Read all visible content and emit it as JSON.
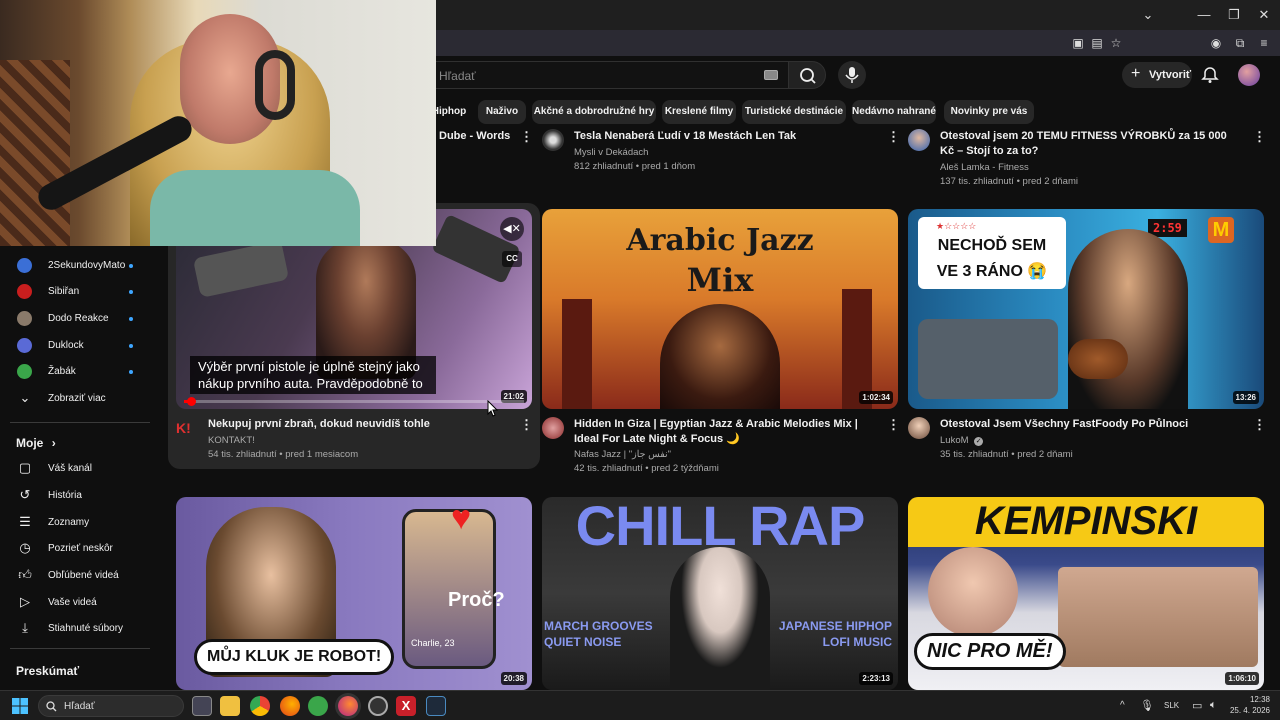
{
  "browser": {
    "controls": {
      "minimize": "—",
      "restore": "❐",
      "close": "✕"
    }
  },
  "header": {
    "search_placeholder": "Hľadať",
    "create_label": "Vytvoriť"
  },
  "chips": [
    "Hiphop",
    "Naživo",
    "Akčné a dobrodružné hry",
    "Kreslené filmy",
    "Turistické destinácie",
    "Nedávno nahrané",
    "Novinky pre vás"
  ],
  "sidebar": {
    "subscriptions": [
      {
        "name": "2SekundovyMato",
        "color": "#3b6fd6"
      },
      {
        "name": "Sibiřan",
        "color": "#c81e1e"
      },
      {
        "name": "Dodo Reakce",
        "color": "#8a7a6a"
      },
      {
        "name": "Duklock",
        "color": "#5a6ad6"
      },
      {
        "name": "Žabák",
        "color": "#3aa64a"
      }
    ],
    "show_more": "Zobraziť viac",
    "you_title": "Moje",
    "you_items": [
      {
        "label": "Váš kanál",
        "icon": "channel-icon"
      },
      {
        "label": "História",
        "icon": "history-icon"
      },
      {
        "label": "Zoznamy",
        "icon": "playlists-icon"
      },
      {
        "label": "Pozrieť neskôr",
        "icon": "watch-later-icon"
      },
      {
        "label": "Obľúbené videá",
        "icon": "liked-icon"
      },
      {
        "label": "Vaše videá",
        "icon": "your-videos-icon"
      },
      {
        "label": "Stiahnuté súbory",
        "icon": "downloads-icon"
      }
    ],
    "explore_title": "Preskúmať"
  },
  "top_row": [
    {
      "title": "Dube - Words"
    },
    {
      "title": "Tesla Nenaberá Ľudí v 18 Mestách Len Tak",
      "channel": "Mysli v Dekádach",
      "meta": "812 zhliadnutí • pred 1 dňom"
    },
    {
      "title": "Otestoval jsem 20 TEMU FITNESS VÝROBKŮ za 15 000 Kč – Stojí to za to?",
      "channel": "Aleš Lamka - Fitness",
      "meta": "137 tis. zhliadnutí • pred 2 dňami"
    }
  ],
  "row2": [
    {
      "title": "Nekupuj první zbraň, dokud neuvidíš tohle",
      "channel": "KONTAKT!",
      "meta": "54 tis. zhliadnutí • pred 1 mesiacom",
      "duration": "21:02",
      "caption": "Výběr první pistole je úplně stejný jako nákup prvního auta. Pravděpodobně to",
      "progress": 0.02
    },
    {
      "title": "Hidden In Giza | Egyptian Jazz & Arabic Melodies Mix | Ideal For Late Night & Focus 🌙",
      "channel": "Nafas Jazz | \"نفس جاز\"",
      "meta": "42 tis. zhliadnutí • pred 2 týždňami",
      "duration": "1:02:34",
      "thumb_text": [
        "Arabic Jazz",
        "Mix"
      ]
    },
    {
      "title": "Otestoval Jsem Všechny FastFoody Po Půlnoci",
      "channel": "LukoM",
      "meta": "35 tis. zhliadnutí • pred 2 dňami",
      "duration": "13:26",
      "thumb_text": [
        "NECHOĎ SEM",
        "VE 3 RÁNO 😭"
      ],
      "clock": "2:59"
    }
  ],
  "row3": [
    {
      "duration": "20:38",
      "thumb_text": [
        "MŮJ KLUK JE ROBOT!",
        "Proč?",
        "Charlie, 23"
      ]
    },
    {
      "duration": "2:23:13",
      "thumb_text": [
        "CHILL RAP",
        "MARCH GROOVES",
        "QUIET NOISE",
        "JAPANESE HIPHOP",
        "LOFI MUSIC"
      ]
    },
    {
      "duration": "1:06:10",
      "thumb_text": [
        "KEMPINSKI",
        "NIC PRO MĚ!"
      ]
    }
  ],
  "taskbar": {
    "search_label": "Hľadať",
    "lang": "SLK",
    "time": "12:38",
    "date": "25. 4. 2026"
  }
}
